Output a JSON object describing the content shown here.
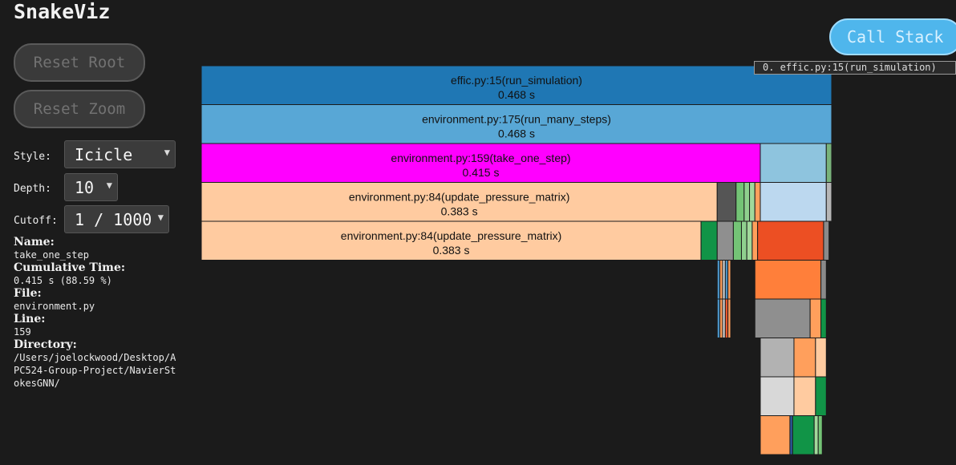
{
  "app": {
    "title": "SnakeViz"
  },
  "controls": {
    "reset_root": "Reset Root",
    "reset_zoom": "Reset Zoom",
    "style_label": "Style:",
    "style_value": "Icicle",
    "depth_label": "Depth:",
    "depth_value": "10",
    "cutoff_label": "Cutoff:",
    "cutoff_value": "1 / 1000"
  },
  "info": {
    "name_label": "Name:",
    "name_value": "take_one_step",
    "cumtime_label": "Cumulative Time:",
    "cumtime_value": "0.415 s (88.59 %)",
    "file_label": "File:",
    "file_value": "environment.py",
    "line_label": "Line:",
    "line_value": "159",
    "dir_label": "Directory:",
    "dir_value": "/Users/joelockwood/Desktop/APC524-Group-Project/NavierStokesGNN/"
  },
  "call_stack": {
    "button_label": "Call Stack",
    "items": [
      "0. effic.py:15(run_simulation)"
    ]
  },
  "icicle": {
    "total_seconds": 0.468,
    "levels": [
      [
        {
          "name": "effic.py:15(run_simulation)",
          "time": "0.468 s",
          "value": 0.468,
          "color": "#1f77b4"
        }
      ],
      [
        {
          "name": "environment.py:175(run_many_steps)",
          "time": "0.468 s",
          "value": 0.468,
          "color": "#58a7d6"
        }
      ],
      [
        {
          "name": "environment.py:159(take_one_step)",
          "time": "0.415 s",
          "value": 0.415,
          "color": "#ff00ff"
        },
        {
          "value": 0.049,
          "color": "#8ec4de"
        },
        {
          "value": 0.004,
          "color": "#79b37b"
        }
      ],
      [
        {
          "name": "environment.py:84(update_pressure_matrix)",
          "time": "0.383 s",
          "value": 0.383,
          "color": "#ffcba0"
        },
        {
          "value": 0.014,
          "color": "#555555"
        },
        {
          "value": 0.006,
          "color": "#74c476"
        },
        {
          "value": 0.004,
          "color": "#8fd08e"
        },
        {
          "value": 0.004,
          "color": "#a1d99b"
        },
        {
          "value": 0.004,
          "color": "#ff9f5c"
        },
        {
          "value": 0.049,
          "color": "#bcd8ef"
        },
        {
          "value": 0.004,
          "color": "#b6b6b6"
        }
      ],
      [
        {
          "name": "environment.py:84(update_pressure_matrix)",
          "time": "0.383 s",
          "value": 0.371,
          "color": "#ffcba0"
        },
        {
          "value": 0.012,
          "color": "#119447"
        },
        {
          "value": 0.012,
          "color": "#8f8f8f"
        },
        {
          "value": 0.006,
          "color": "#74c476"
        },
        {
          "value": 0.004,
          "color": "#8fd08e"
        },
        {
          "value": 0.004,
          "color": "#a1d99b"
        },
        {
          "value": 0.004,
          "color": "#ff9f5c"
        },
        {
          "value": 0.049,
          "color": "#ec4f23"
        },
        {
          "value": 0.004,
          "color": "#8a8a8a"
        }
      ],
      [
        {
          "gap": 0.383
        },
        {
          "value": 0.002,
          "color": "#4a90c2"
        },
        {
          "value": 0.002,
          "color": "#ff9f5c"
        },
        {
          "value": 0.002,
          "color": "#d0d0d0"
        },
        {
          "value": 0.002,
          "color": "#4a90c2"
        },
        {
          "value": 0.002,
          "color": "#ff9f5c"
        },
        {
          "gap": 0.018
        },
        {
          "value": 0.049,
          "color": "#ff7f3a"
        },
        {
          "value": 0.004,
          "color": "#8a8a8a"
        }
      ],
      [
        {
          "gap": 0.383
        },
        {
          "value": 0.002,
          "color": "#4a90c2"
        },
        {
          "value": 0.002,
          "color": "#ff9f5c"
        },
        {
          "value": 0.002,
          "color": "#d0d0d0"
        },
        {
          "value": 0.002,
          "color": "#e9572d"
        },
        {
          "value": 0.002,
          "color": "#ff9f5c"
        },
        {
          "gap": 0.018
        },
        {
          "value": 0.041,
          "color": "#8f8f8f"
        },
        {
          "value": 0.008,
          "color": "#ff9f5c"
        },
        {
          "value": 0.004,
          "color": "#119447"
        }
      ],
      [
        {
          "gap": 0.415
        },
        {
          "value": 0.025,
          "color": "#b2b2b2"
        },
        {
          "value": 0.016,
          "color": "#ff9f5c"
        },
        {
          "value": 0.008,
          "color": "#ffcba0"
        }
      ],
      [
        {
          "gap": 0.415
        },
        {
          "value": 0.025,
          "color": "#d8d8d8"
        },
        {
          "value": 0.016,
          "color": "#ffcba0"
        },
        {
          "value": 0.008,
          "color": "#119447"
        }
      ],
      [
        {
          "gap": 0.415
        },
        {
          "value": 0.022,
          "color": "#ff9f5c"
        },
        {
          "value": 0.002,
          "color": "#2c5aa0"
        },
        {
          "value": 0.016,
          "color": "#119447"
        },
        {
          "value": 0.003,
          "color": "#a1d99b"
        },
        {
          "value": 0.003,
          "color": "#74c476"
        }
      ]
    ]
  }
}
